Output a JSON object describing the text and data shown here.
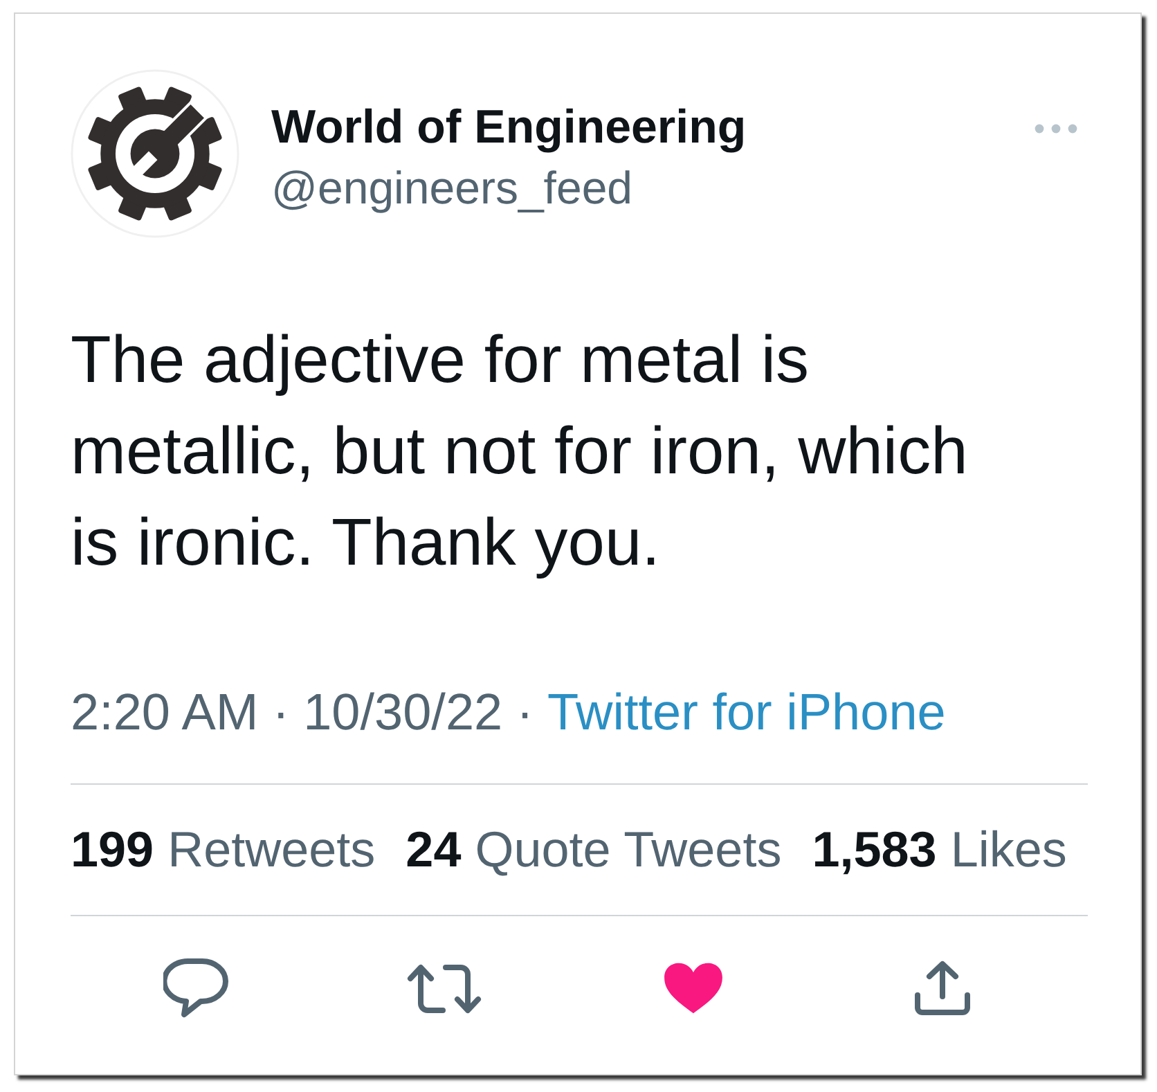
{
  "tweet": {
    "author": {
      "name": "World of Engineering",
      "handle": "@engineers_feed"
    },
    "text": "The adjective for metal is metallic, but not for iron, which is ironic. Thank you.",
    "meta": [
      {
        "kind": "time",
        "text": "2:20 AM"
      },
      {
        "kind": "separator",
        "text": "·"
      },
      {
        "kind": "date",
        "text": "10/30/22"
      },
      {
        "kind": "separator",
        "text": "·"
      },
      {
        "kind": "source",
        "text": "Twitter for iPhone"
      }
    ],
    "stats": [
      {
        "count": "199",
        "label": "Retweets"
      },
      {
        "count": "24",
        "label": "Quote Tweets"
      },
      {
        "count": "1,583",
        "label": "Likes"
      }
    ],
    "actions": [
      {
        "kind": "reply",
        "on": false
      },
      {
        "kind": "retweet",
        "on": false
      },
      {
        "kind": "like",
        "on": true
      },
      {
        "kind": "share",
        "on": false
      }
    ]
  }
}
